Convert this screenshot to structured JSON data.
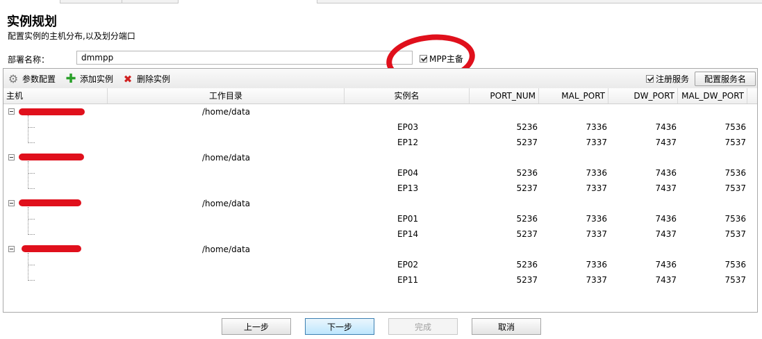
{
  "header": {
    "title": "实例规划",
    "subtitle": "配置实例的主机分布,以及划分端口"
  },
  "deploy": {
    "label": "部署名称：",
    "value": "dmmpp",
    "mpp_label": "MPP主备",
    "mpp_checked": true
  },
  "toolbar": {
    "params_label": "参数配置",
    "add_label": "添加实例",
    "delete_label": "删除实例",
    "register_label": "注册服务",
    "register_checked": true,
    "config_service_label": "配置服务名"
  },
  "table": {
    "columns": [
      "主机",
      "工作目录",
      "实例名",
      "PORT_NUM",
      "MAL_PORT",
      "DW_PORT",
      "MAL_DW_PORT"
    ],
    "groups": [
      {
        "workdir": "/home/data",
        "instances": [
          {
            "name": "EP03",
            "port_num": "5236",
            "mal_port": "7336",
            "dw_port": "7436",
            "mal_dw_port": "7536"
          },
          {
            "name": "EP12",
            "port_num": "5237",
            "mal_port": "7337",
            "dw_port": "7437",
            "mal_dw_port": "7537"
          }
        ]
      },
      {
        "workdir": "/home/data",
        "instances": [
          {
            "name": "EP04",
            "port_num": "5236",
            "mal_port": "7336",
            "dw_port": "7436",
            "mal_dw_port": "7536"
          },
          {
            "name": "EP13",
            "port_num": "5237",
            "mal_port": "7337",
            "dw_port": "7437",
            "mal_dw_port": "7537"
          }
        ]
      },
      {
        "workdir": "/home/data",
        "instances": [
          {
            "name": "EP01",
            "port_num": "5236",
            "mal_port": "7336",
            "dw_port": "7436",
            "mal_dw_port": "7536"
          },
          {
            "name": "EP14",
            "port_num": "5237",
            "mal_port": "7337",
            "dw_port": "7437",
            "mal_dw_port": "7537"
          }
        ]
      },
      {
        "workdir": "/home/data",
        "instances": [
          {
            "name": "EP02",
            "port_num": "5236",
            "mal_port": "7336",
            "dw_port": "7436",
            "mal_dw_port": "7536"
          },
          {
            "name": "EP11",
            "port_num": "5237",
            "mal_port": "7337",
            "dw_port": "7437",
            "mal_dw_port": "7537"
          }
        ]
      }
    ]
  },
  "buttons": {
    "prev": "上一步",
    "next": "下一步",
    "finish": "完成",
    "cancel": "取消"
  },
  "colors": {
    "annotation_red": "#e0101c",
    "primary_button": "#bee6fd"
  }
}
